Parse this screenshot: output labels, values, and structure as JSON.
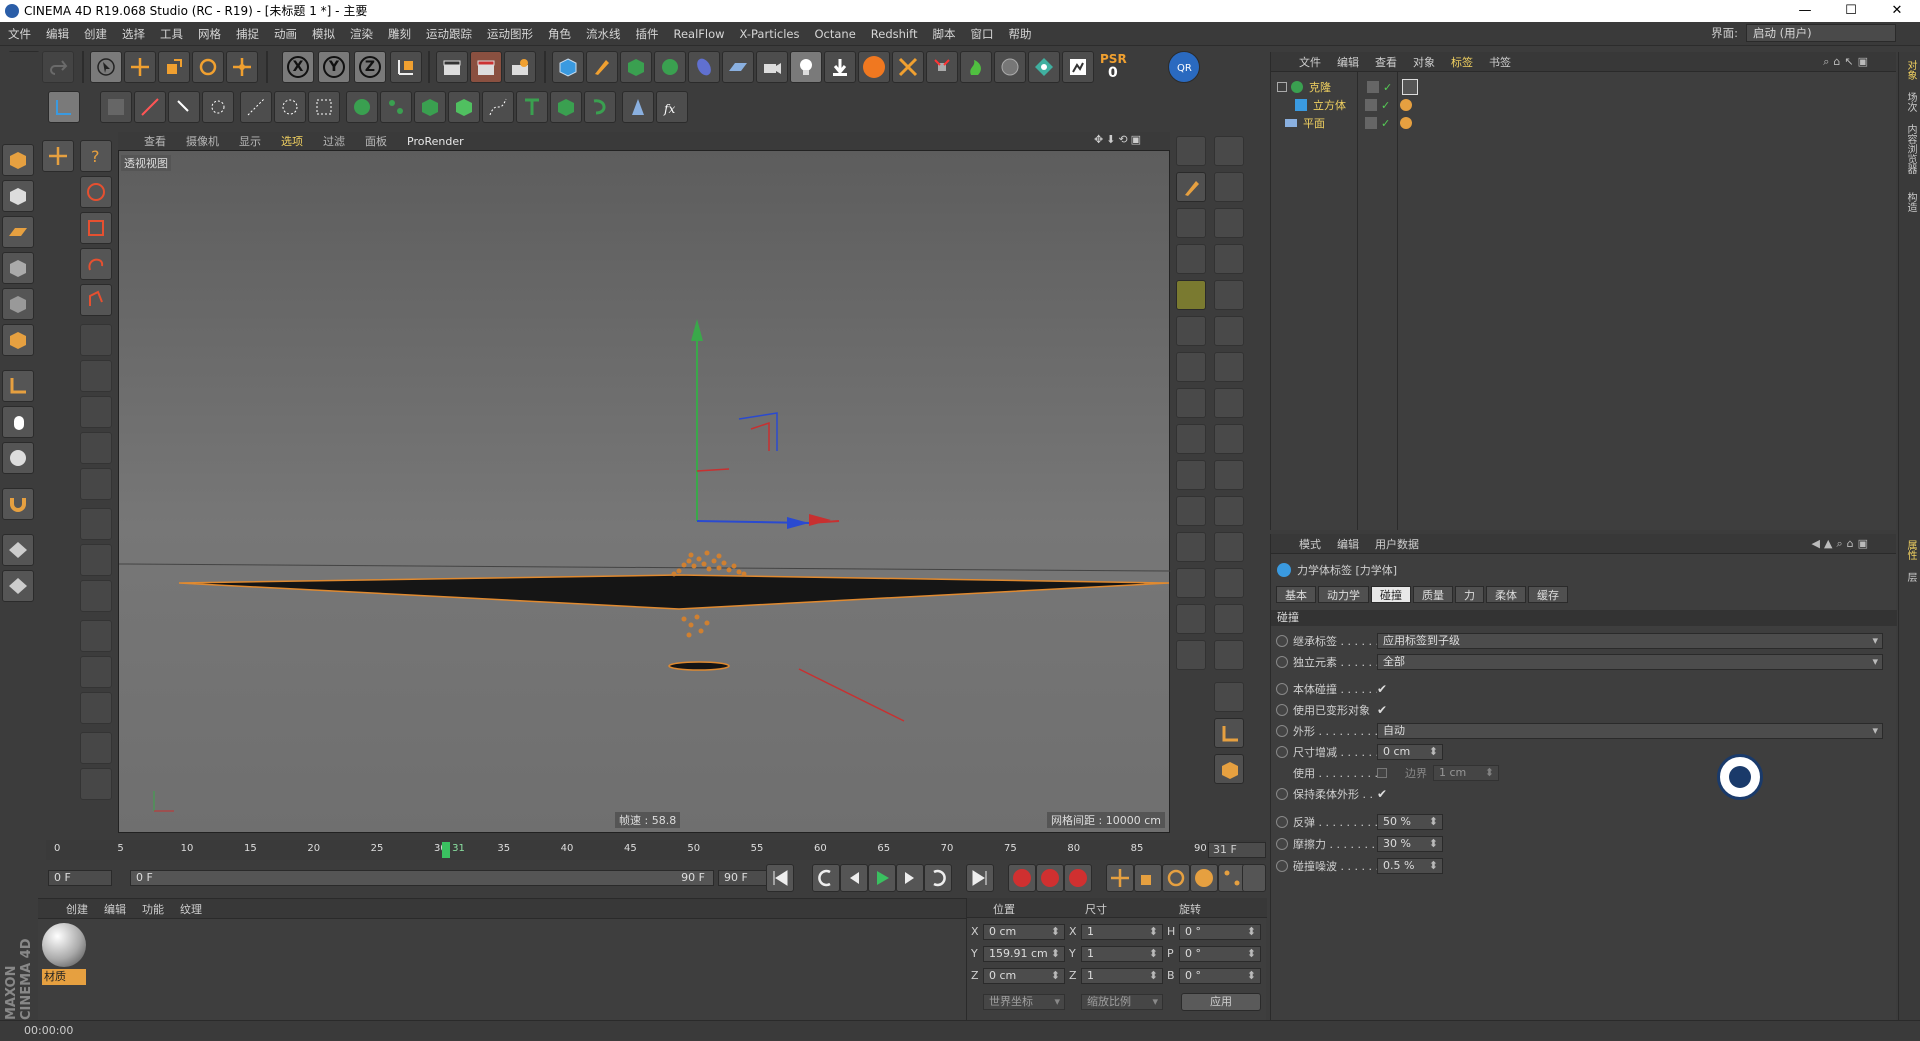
{
  "window": {
    "title": "CINEMA 4D R19.068 Studio (RC - R19) - [未标题 1 *] - 主要",
    "min": "—",
    "max": "☐",
    "close": "✕"
  },
  "menu": [
    "文件",
    "编辑",
    "创建",
    "选择",
    "工具",
    "网格",
    "捕捉",
    "动画",
    "模拟",
    "渲染",
    "雕刻",
    "运动跟踪",
    "运动图形",
    "角色",
    "流水线",
    "插件",
    "RealFlow",
    "X-Particles",
    "Octane",
    "Redshift",
    "脚本",
    "窗口",
    "帮助"
  ],
  "layout": {
    "label": "界面:",
    "value": "启动 (用户)"
  },
  "toolbar": {
    "axis_x": "X",
    "axis_y": "Y",
    "axis_z": "Z",
    "psr": "PSR",
    "psr_value": "0"
  },
  "viewport": {
    "menu": [
      "查看",
      "摄像机",
      "显示",
      "选项",
      "过滤",
      "面板"
    ],
    "prorender": "ProRender",
    "view_label": "透视视图",
    "fps": "帧速 : 58.8",
    "grid": "网格间距 : 10000 cm"
  },
  "objects": {
    "menu": [
      "文件",
      "编辑",
      "查看",
      "对象",
      "标签",
      "书签"
    ],
    "items": [
      {
        "name": "克隆"
      },
      {
        "name": "立方体"
      },
      {
        "name": "平面"
      }
    ]
  },
  "attributes": {
    "menu": [
      "模式",
      "编辑",
      "用户数据"
    ],
    "tag_title": "力学体标签 [力学体]",
    "tabs": [
      "基本",
      "动力学",
      "碰撞",
      "质量",
      "力",
      "柔体",
      "缓存"
    ],
    "section": "碰撞",
    "rows": [
      {
        "label": "继承标签 . . . . . . . .",
        "value": "应用标签到子级"
      },
      {
        "label": "独立元素 . . . . . . . .",
        "value": "全部"
      },
      {
        "label": "本体碰撞 . . . . . . . .",
        "check": "✔"
      },
      {
        "label": "使用已变形对象",
        "check": "✔"
      },
      {
        "label": "外形 . . . . . . . . . . . .",
        "value": "自动"
      },
      {
        "label": "尺寸增减 . . . . . . . .",
        "value": "0 cm"
      },
      {
        "label": "使用 . . . . . . . . . . . .",
        "extra": "边界",
        "extra_value": "1 cm"
      },
      {
        "label": "保持柔体外形 . . .",
        "check": "✔"
      },
      {
        "label": "反弹 . . . . . . . . . . . .",
        "value": "50 %"
      },
      {
        "label": "摩擦力 . . . . . . . . . .",
        "value": "30 %"
      },
      {
        "label": "碰撞噪波 . . . . . . . .",
        "value": "0.5 %"
      }
    ]
  },
  "timeline": {
    "ticks": [
      "0",
      "5",
      "10",
      "15",
      "20",
      "25",
      "30",
      "35",
      "40",
      "45",
      "50",
      "55",
      "60",
      "65",
      "70",
      "75",
      "80",
      "85",
      "90"
    ],
    "current": "31",
    "frame_display": "31 F",
    "progress": 0.344
  },
  "transport": {
    "start": "0 F",
    "range_start": "0 F",
    "range_end": "90 F",
    "end": "90 F"
  },
  "materials": {
    "menu": [
      "创建",
      "编辑",
      "功能",
      "纹理"
    ],
    "mat_name": "材质"
  },
  "coords": {
    "headers": [
      "位置",
      "尺寸",
      "旋转"
    ],
    "rows": [
      [
        "X",
        "0 cm",
        "X",
        "1",
        "H",
        "0 °"
      ],
      [
        "Y",
        "159.91 cm",
        "Y",
        "1",
        "P",
        "0 °"
      ],
      [
        "Z",
        "0 cm",
        "Z",
        "1",
        "B",
        "0 °"
      ]
    ],
    "world": "世界坐标",
    "scale": "缩放比例",
    "apply": "应用"
  },
  "status": {
    "time": "00:00:00"
  },
  "brand": "MAXON CINEMA 4D",
  "right_tabs": [
    "对象",
    "场次",
    "内容浏览器",
    "构造"
  ],
  "right_tabs2": [
    "属性",
    "层"
  ],
  "colors": {
    "accent": "#f0a030",
    "highlight": "#f0d060"
  }
}
